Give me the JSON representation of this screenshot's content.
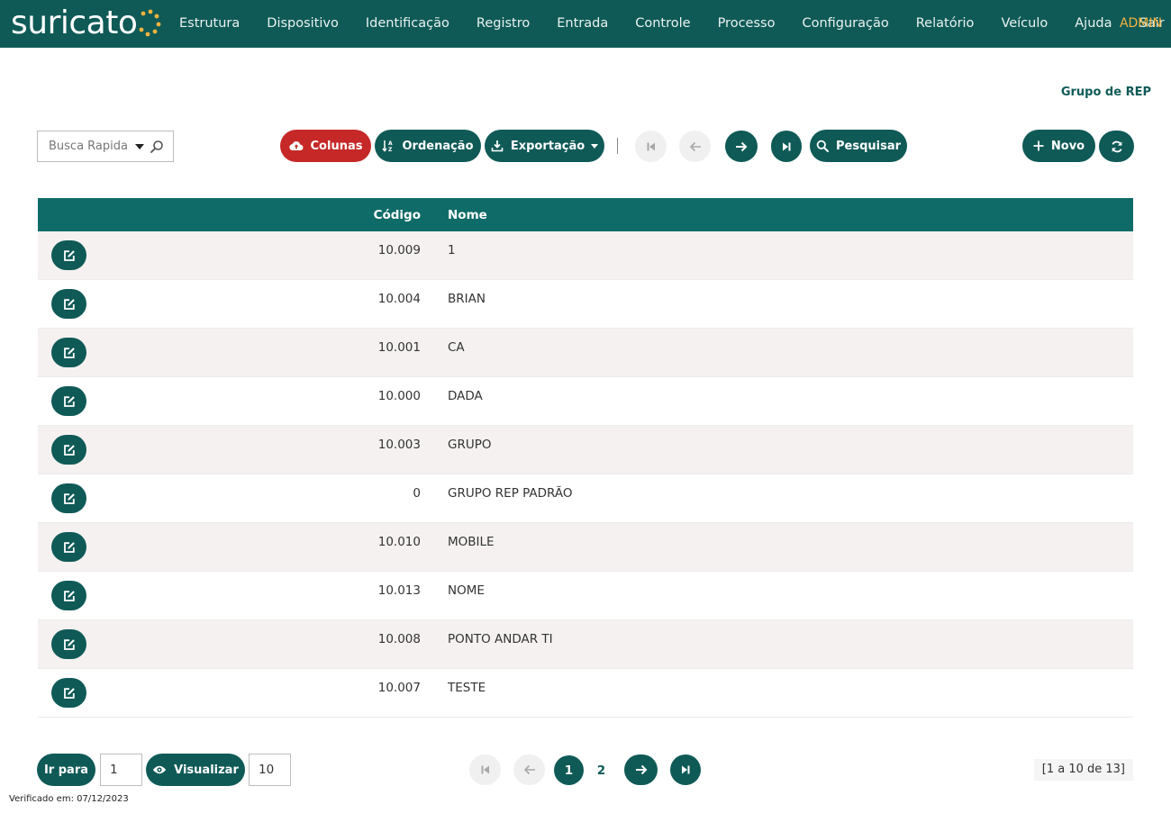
{
  "header": {
    "logo_text": "suricato",
    "nav": [
      "Estrutura",
      "Dispositivo",
      "Identificação",
      "Registro",
      "Entrada",
      "Controle",
      "Processo",
      "Configuração",
      "Relatório",
      "Veículo",
      "Ajuda",
      "Sair"
    ],
    "user": "ADMIN"
  },
  "page": {
    "title": "Grupo de REP"
  },
  "toolbar": {
    "search_placeholder": "Busca Rapida",
    "columns_label": "Colunas",
    "sort_label": "Ordenação",
    "export_label": "Exportação",
    "search_label": "Pesquisar",
    "new_label": "Novo"
  },
  "table": {
    "headers": {
      "code": "Código",
      "name": "Nome"
    },
    "rows": [
      {
        "code": "10.009",
        "name": "1"
      },
      {
        "code": "10.004",
        "name": "BRIAN"
      },
      {
        "code": "10.001",
        "name": "CA"
      },
      {
        "code": "10.000",
        "name": "DADA"
      },
      {
        "code": "10.003",
        "name": "GRUPO"
      },
      {
        "code": "0",
        "name": "GRUPO REP PADRÃO"
      },
      {
        "code": "10.010",
        "name": "MOBILE"
      },
      {
        "code": "10.013",
        "name": "NOME"
      },
      {
        "code": "10.008",
        "name": "PONTO ANDAR TI"
      },
      {
        "code": "10.007",
        "name": "TESTE"
      }
    ]
  },
  "footer": {
    "goto_label": "Ir para",
    "goto_value": "1",
    "view_label": "Visualizar",
    "page_size": "10",
    "pages": [
      "1",
      "2"
    ],
    "current_page": "1",
    "range_text": "[1 a 10 de 13]",
    "verified_text": "Verificado em: 07/12/2023"
  },
  "colors": {
    "primary": "#0f5a57",
    "header_row": "#0f6b68",
    "danger": "#c62828",
    "admin": "#f3b33d"
  }
}
